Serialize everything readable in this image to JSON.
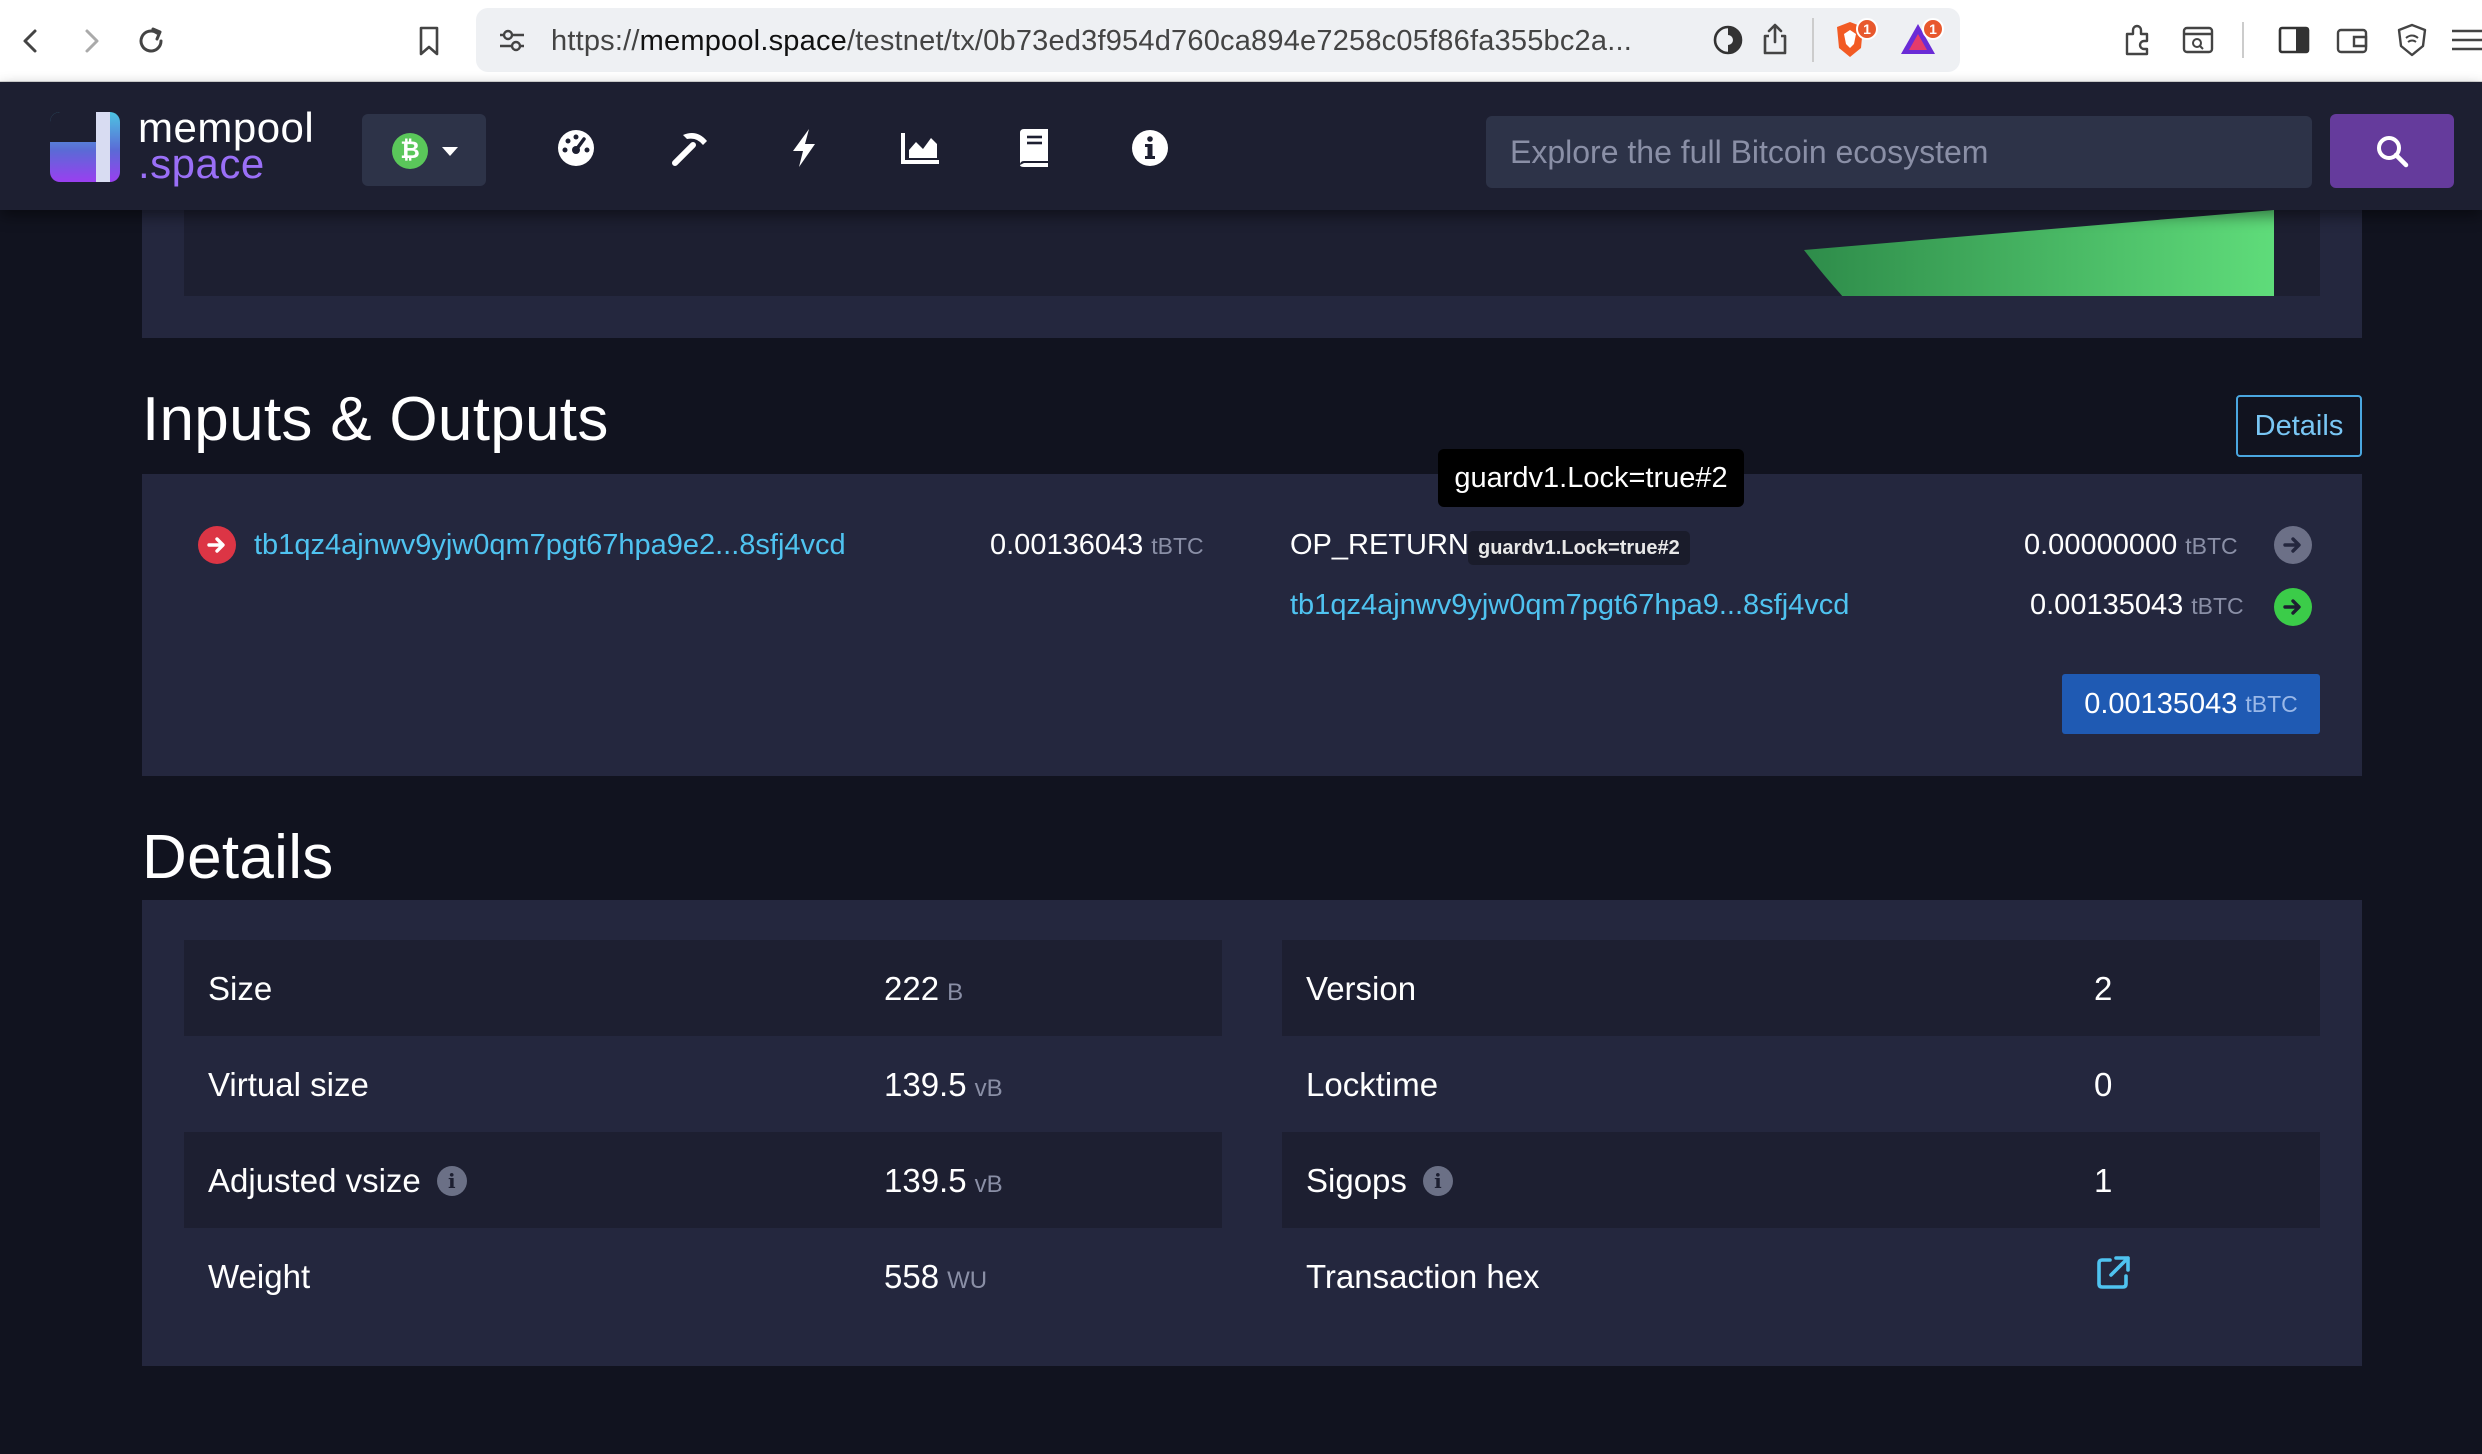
{
  "browser": {
    "url_prefix": "https://",
    "url_host": "mempool.space",
    "url_path": "/testnet/tx/0b73ed3f954d760ca894e7258c05f86fa355bc2a...",
    "brave_badge": "1",
    "rewards_badge": "1"
  },
  "navbar": {
    "logo_line1": "mempool",
    "logo_line2": ".space",
    "network_symbol": "₿",
    "search_placeholder": "Explore the full Bitcoin ecosystem",
    "icons": [
      "dashboard-icon",
      "mining-icon",
      "lightning-icon",
      "graphs-icon",
      "docs-icon",
      "about-icon"
    ]
  },
  "io": {
    "title": "Inputs & Outputs",
    "details_button": "Details",
    "tooltip": "guardv1.Lock=true#2",
    "input": {
      "address": "tb1qz4ajnwv9yjw0qm7pgt67hpa9e2...8sfj4vcd",
      "amount": "0.00136043",
      "unit": "tBTC"
    },
    "outputs": [
      {
        "label": "OP_RETURN",
        "tag": "guardv1.Lock=true#2",
        "amount": "0.00000000",
        "unit": "tBTC"
      },
      {
        "address": "tb1qz4ajnwv9yjw0qm7pgt67hpa9...8sfj4vcd",
        "amount": "0.00135043",
        "unit": "tBTC"
      }
    ],
    "total": {
      "amount": "0.00135043",
      "unit": "tBTC"
    }
  },
  "details": {
    "title": "Details",
    "left": [
      {
        "label": "Size",
        "value": "222",
        "unit": "B"
      },
      {
        "label": "Virtual size",
        "value": "139.5",
        "unit": "vB"
      },
      {
        "label": "Adjusted vsize",
        "value": "139.5",
        "unit": "vB"
      },
      {
        "label": "Weight",
        "value": "558",
        "unit": "WU"
      }
    ],
    "right": [
      {
        "label": "Version",
        "value": "2"
      },
      {
        "label": "Locktime",
        "value": "0"
      },
      {
        "label": "Sigops",
        "value": "1"
      },
      {
        "label": "Transaction hex",
        "value": ""
      }
    ]
  },
  "colors": {
    "background": "#11131f",
    "panel": "#24273e",
    "row_dark": "#1d1f31",
    "link": "#4fc3f0",
    "input_arrow": "#dc3545",
    "output_arrow_spent": "#6c7087",
    "output_arrow_unspent": "#3bcc49",
    "total_pill": "#1f5ab3",
    "search_button": "#653b9c"
  }
}
